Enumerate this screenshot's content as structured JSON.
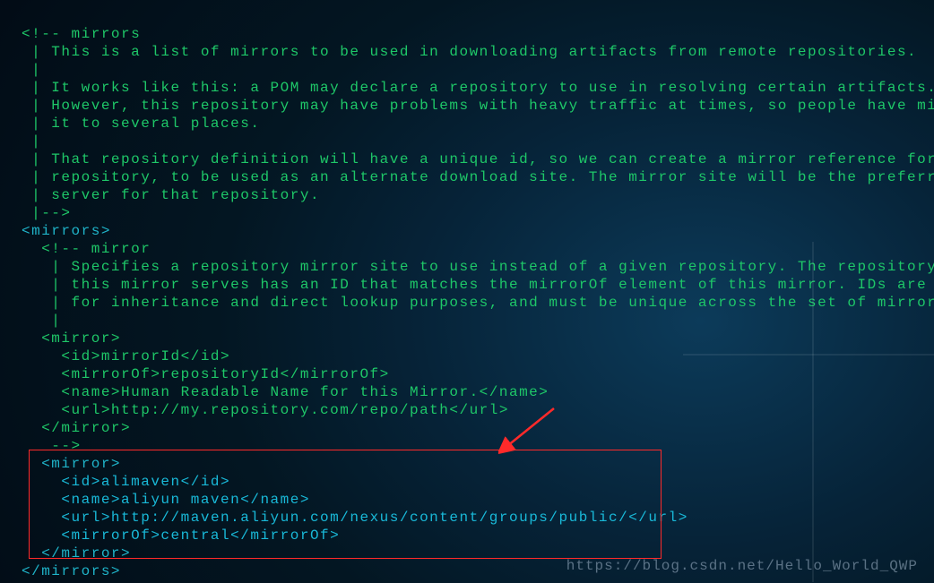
{
  "code": {
    "c1": "<!-- mirrors",
    "c2": " | This is a list of mirrors to be used in downloading artifacts from remote repositories.",
    "c3": " |",
    "c4": " | It works like this: a POM may declare a repository to use in resolving certain artifacts.",
    "c5": " | However, this repository may have problems with heavy traffic at times, so people have mirrored",
    "c6": " | it to several places.",
    "c7": " |",
    "c8": " | That repository definition will have a unique id, so we can create a mirror reference for that",
    "c9": " | repository, to be used as an alternate download site. The mirror site will be the preferred",
    "c10": " | server for that repository.",
    "c11": " |-->",
    "m_open": "<mirrors>",
    "c12": "  <!-- mirror",
    "c13": "   | Specifies a repository mirror site to use instead of a given repository. The repository that",
    "c14": "   | this mirror serves has an ID that matches the mirrorOf element of this mirror. IDs are used",
    "c15": "   | for inheritance and direct lookup purposes, and must be unique across the set of mirrors.",
    "c16": "   |",
    "c17": "  <mirror>",
    "c18": "    <id>mirrorId</id>",
    "c19": "    <mirrorOf>repositoryId</mirrorOf>",
    "c20": "    <name>Human Readable Name for this Mirror.</name>",
    "c21": "    <url>http://my.repository.com/repo/path</url>",
    "c22": "  </mirror>",
    "c23": "   -->",
    "mir_open": "  <mirror>",
    "id_open": "<id>",
    "id_val": "alimaven",
    "id_close": "</id>",
    "name_open": "<name>",
    "name_val": "aliyun maven",
    "name_close": "</name>",
    "url_open": "<url>",
    "url_val": "http://maven.aliyun.com/nexus/content/groups/public/",
    "url_close": "</url>",
    "of_open": "<mirrorOf>",
    "of_val": "central",
    "of_close": "</mirrorOf>",
    "mir_close": "  </mirror>",
    "m_close": "</mirrors>",
    "pad4": "    "
  },
  "watermark": "https://blog.csdn.net/Hello_World_QWP"
}
